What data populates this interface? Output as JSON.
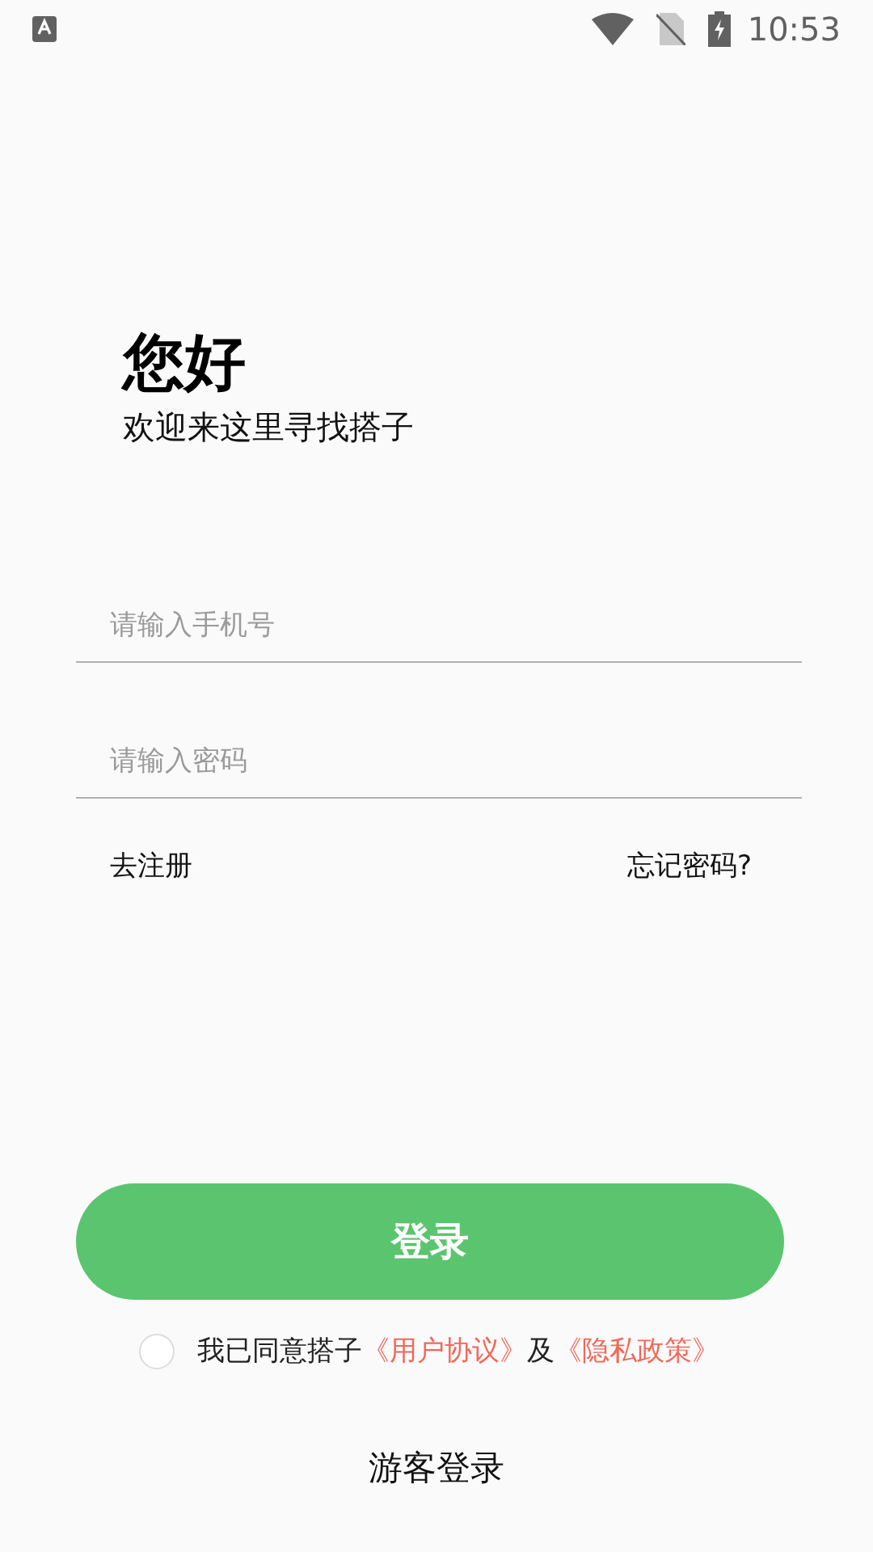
{
  "status_bar": {
    "time": "10:53"
  },
  "greeting": {
    "title": "您好",
    "subtitle": "欢迎来这里寻找搭子"
  },
  "fields": [
    {
      "placeholder": "请输入手机号"
    },
    {
      "placeholder": "请输入密码"
    }
  ],
  "links": {
    "register": "去注册",
    "forgot": "忘记密码?"
  },
  "login_button": "登录",
  "agreement": {
    "checked": false,
    "text": "我已同意搭子",
    "terms": "《用户协议》",
    "and": "及",
    "privacy": "《隐私政策》"
  },
  "guest_login": "游客登录"
}
